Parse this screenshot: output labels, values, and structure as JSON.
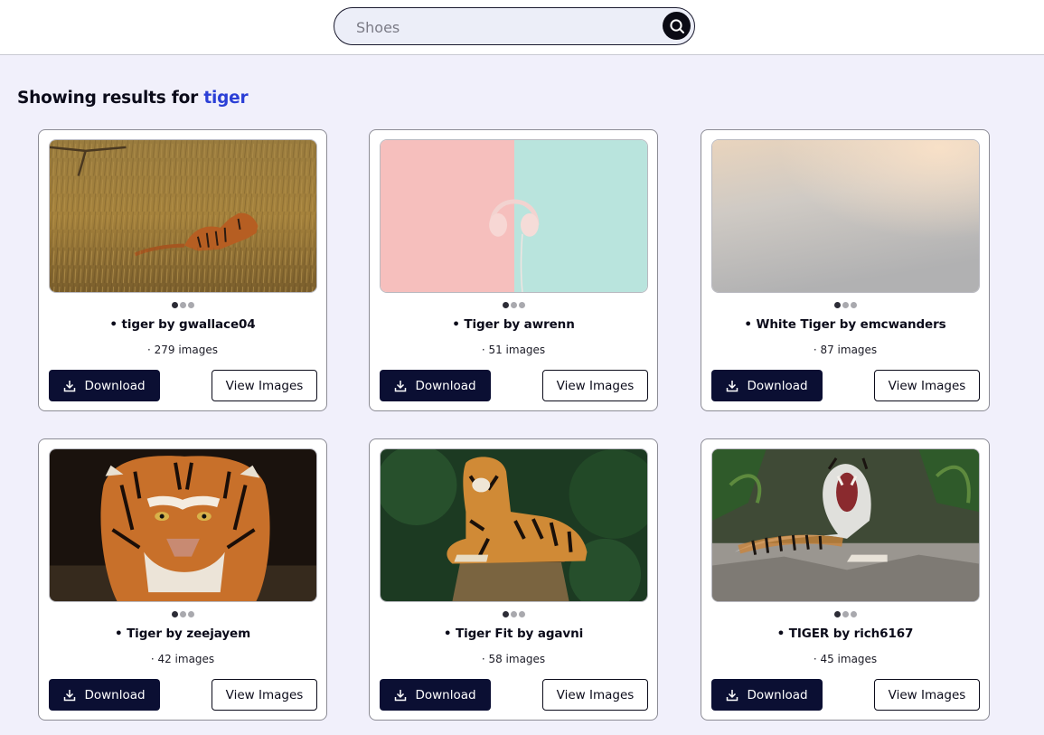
{
  "search": {
    "placeholder": "Shoes",
    "button_icon": "search-icon"
  },
  "results": {
    "prefix": "Showing results for ",
    "query": "tiger",
    "query_color": "#2b3fd6"
  },
  "cards": [
    {
      "title": "• tiger by gwallace04",
      "count": "· 279 images",
      "download_label": "Download",
      "view_label": "View Images",
      "image": "tiger-in-grass"
    },
    {
      "title": "• Tiger by awrenn",
      "count": "· 51 images",
      "download_label": "Download",
      "view_label": "View Images",
      "image": "headphones-pastel"
    },
    {
      "title": "• White Tiger by emcwanders",
      "count": "· 87 images",
      "download_label": "Download",
      "view_label": "View Images",
      "image": "beige-gradient"
    },
    {
      "title": "• Tiger by zeejayem",
      "count": "· 42 images",
      "download_label": "Download",
      "view_label": "View Images",
      "image": "tiger-face"
    },
    {
      "title": "• Tiger Fit by agavni",
      "count": "· 58 images",
      "download_label": "Download",
      "view_label": "View Images",
      "image": "tiger-on-stump"
    },
    {
      "title": "• TIGER by rich6167",
      "count": "· 45 images",
      "download_label": "Download",
      "view_label": "View Images",
      "image": "tiger-roaring"
    }
  ],
  "colors": {
    "download_bg": "#0b0f33",
    "page_bg": "#f1f0fb"
  }
}
